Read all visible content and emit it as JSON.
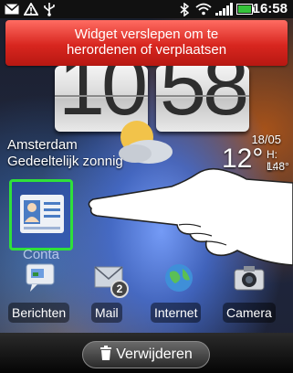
{
  "status_bar": {
    "time": "16:58",
    "icons": [
      "mail-icon",
      "warning-icon",
      "usb-icon",
      "bluetooth-icon",
      "wifi-icon",
      "signal-icon",
      "battery-icon"
    ]
  },
  "banner": {
    "line1": "Widget verslepen om te",
    "line2": "herordenen of verplaatsen"
  },
  "clock": {
    "hours": "10",
    "minutes": "58"
  },
  "weather": {
    "city": "Amsterdam",
    "condition": "Gedeeltelijk zonnig",
    "temperature": "12°",
    "date": "18/05",
    "high": "H: 14°",
    "low": "L: 8°"
  },
  "contact_widget": {
    "label": "Conta"
  },
  "dock": [
    {
      "label": "Berichten",
      "icon": "messages-icon"
    },
    {
      "label": "Mail",
      "icon": "mail-icon",
      "badge": "2"
    },
    {
      "label": "Internet",
      "icon": "globe-icon"
    },
    {
      "label": "Camera",
      "icon": "camera-icon"
    }
  ],
  "delete_bar": {
    "label": "Verwijderen",
    "icon": "trash-icon"
  },
  "colors": {
    "banner": "#d8261f",
    "highlight": "#2fe03a"
  }
}
